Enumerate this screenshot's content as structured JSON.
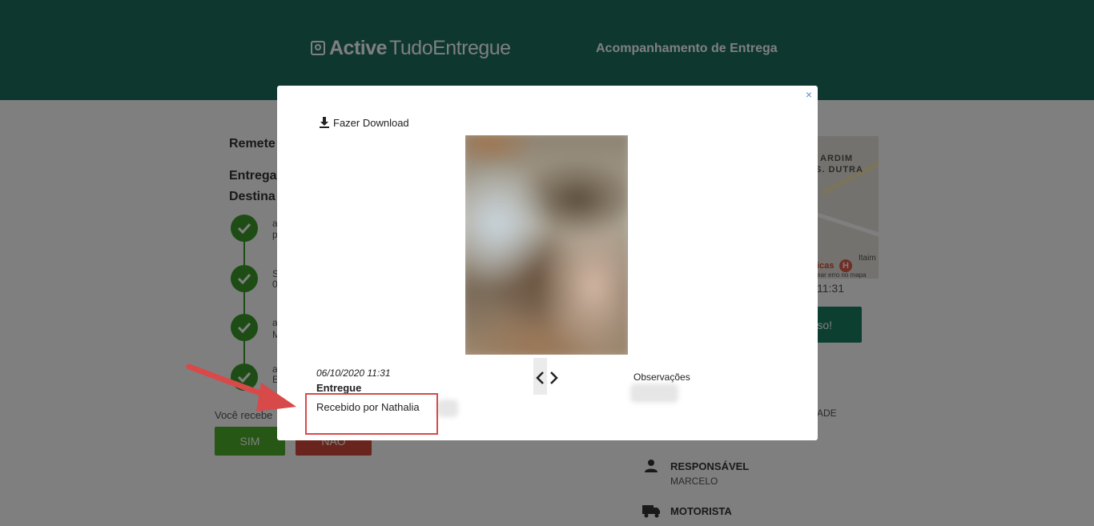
{
  "header": {
    "logo_bold": "Active",
    "logo_rest": "TudoEntregue",
    "title": "Acompanhamento de Entrega"
  },
  "background_page": {
    "remetente_label": "Remete",
    "entrega_label": "Entrega",
    "destinatario_label": "Destina",
    "question_text": "Você recebe",
    "yes_button": "SIM",
    "no_button": "NÃO",
    "map_text_1": "ARDIM",
    "map_text_2": "S. DUTRA",
    "map_text_itaim": "Itaim",
    "map_text_clinica": "icas",
    "map_report": "mar erro no mapa",
    "map_time": "11:31",
    "green_button_label": "so!",
    "side_label_fragment": "ADE",
    "responsavel_label": "RESPONSÁVEL",
    "responsavel_value": "MARCELO",
    "motorista_label": "MOTORISTA",
    "step_1_text_a": "a",
    "step_1_text_b": "p",
    "step_2_text_a": "S",
    "step_2_text_b": "0",
    "step_3_text_a": "a",
    "step_3_text_b": "M",
    "step_4_text_a": "a",
    "step_4_text_b": "E"
  },
  "modal": {
    "close_label": "×",
    "download_label": "Fazer Download",
    "event_date": "06/10/2020 11:31",
    "event_status": "Entregue",
    "event_received": "Recebido por Nathalia",
    "observations_label": "Observações",
    "arrow_left_icon": "chevron-left-icon",
    "arrow_right_icon": "chevron-right-icon"
  },
  "colors": {
    "header_bg": "#1a6f5f",
    "step_green": "#3a9a2a",
    "annotation_red": "#d84a4a"
  }
}
